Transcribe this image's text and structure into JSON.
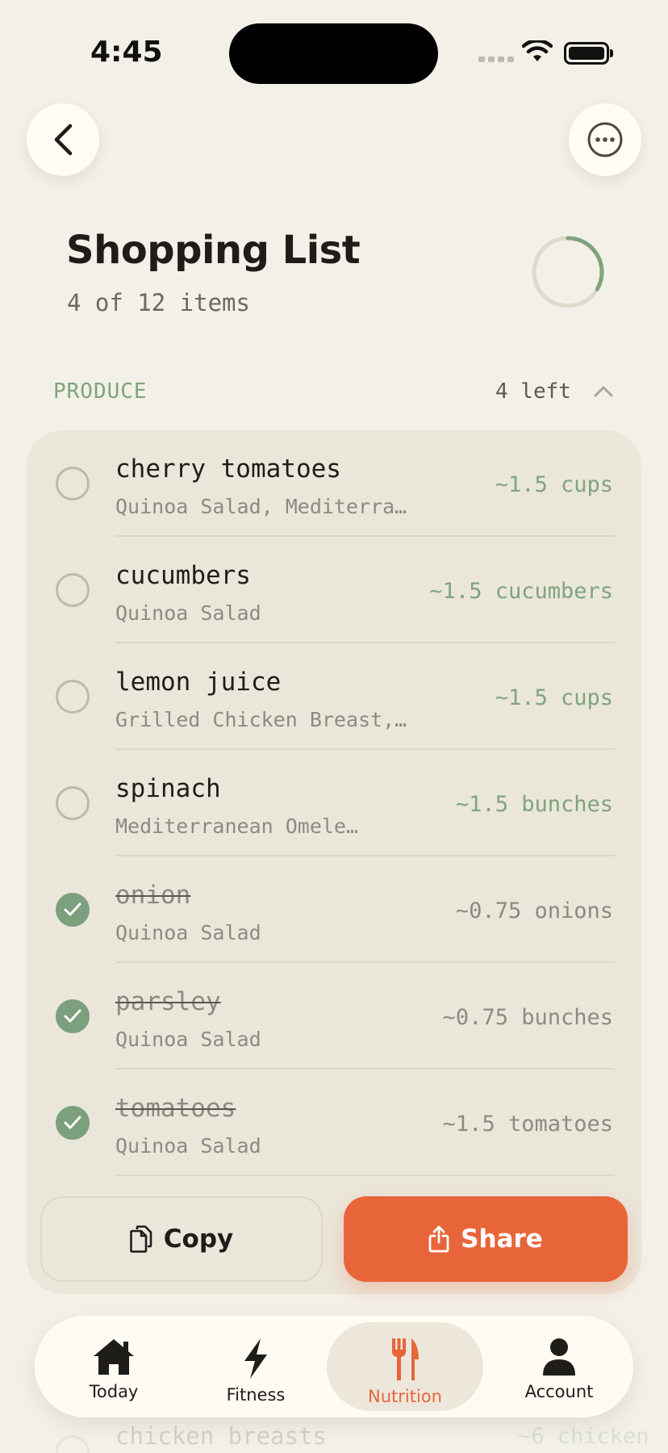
{
  "status_bar": {
    "time": "4:45"
  },
  "header": {
    "title": "Shopping List",
    "subtitle": "4 of 12 items",
    "progress_fraction": 0.3333
  },
  "section": {
    "label": "PRODUCE",
    "count": "4 left"
  },
  "items": [
    {
      "name": "cherry tomatoes",
      "recipe": "Quinoa Salad, Mediterra…",
      "qty": "~1.5 cups",
      "checked": false
    },
    {
      "name": "cucumbers",
      "recipe": "Quinoa Salad",
      "qty": "~1.5 cucumbers",
      "checked": false
    },
    {
      "name": "lemon juice",
      "recipe": "Grilled Chicken Breast,…",
      "qty": "~1.5 cups",
      "checked": false
    },
    {
      "name": "spinach",
      "recipe": "Mediterranean Omele…",
      "qty": "~1.5 bunches",
      "checked": false
    },
    {
      "name": "onion",
      "recipe": "Quinoa Salad",
      "qty": "~0.75 onions",
      "checked": true
    },
    {
      "name": "parsley",
      "recipe": "Quinoa Salad",
      "qty": "~0.75 bunches",
      "checked": true
    },
    {
      "name": "tomatoes",
      "recipe": "Quinoa Salad",
      "qty": "~1.5 tomatoes",
      "checked": true
    }
  ],
  "actions": {
    "copy_label": "Copy",
    "share_label": "Share"
  },
  "ghost": {
    "name": "chicken breasts",
    "qty": "~6 chicken"
  },
  "tabs": [
    {
      "label": "Today",
      "icon": "home-icon"
    },
    {
      "label": "Fitness",
      "icon": "bolt-icon"
    },
    {
      "label": "Nutrition",
      "icon": "fork-knife-icon",
      "active": true
    },
    {
      "label": "Account",
      "icon": "person-icon"
    }
  ],
  "colors": {
    "background": "#f3f0e8",
    "accent": "#e8653a",
    "green": "#7fa47d",
    "card": "#ebe6da"
  }
}
